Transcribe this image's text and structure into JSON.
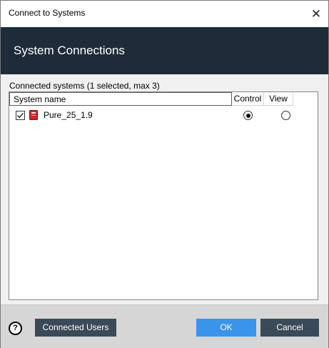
{
  "window": {
    "title": "Connect to Systems",
    "close_glyph": "✕"
  },
  "header": {
    "title": "System Connections"
  },
  "systems": {
    "label": "Connected systems (1 selected, max 3)",
    "columns": {
      "name": "System name",
      "control": "Control",
      "view": "View"
    },
    "rows": [
      {
        "name": "Pure_25_1.9",
        "checked": true,
        "mode": "control",
        "icon": "system-icon"
      }
    ]
  },
  "footer": {
    "help_glyph": "?",
    "connected_users_label": "Connected Users",
    "ok_label": "OK",
    "cancel_label": "Cancel"
  },
  "colors": {
    "header_bg": "#1e2c39",
    "ok_button": "#3a94e9",
    "secondary_button": "#3b4a58",
    "system_icon": "#c8282b"
  }
}
